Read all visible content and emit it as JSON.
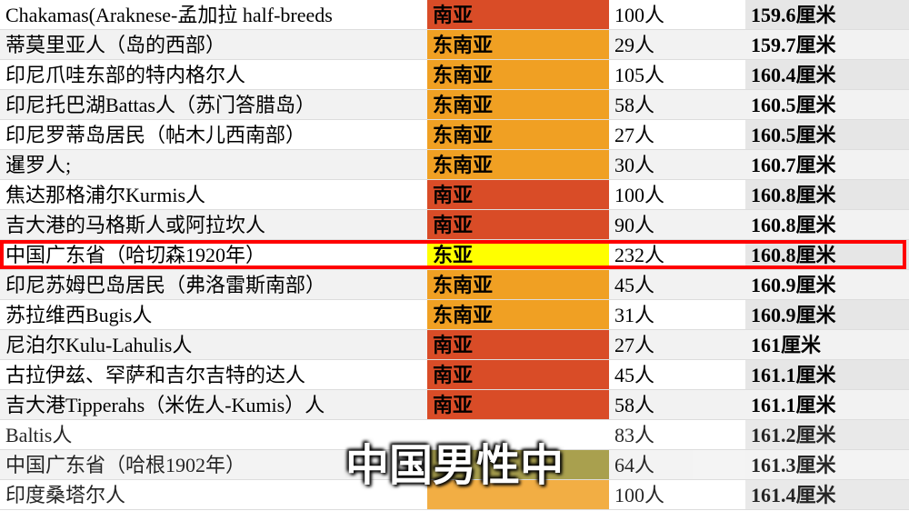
{
  "caption": "中国男性中",
  "region_colors": {
    "南亚": "region-south-asia",
    "东南亚": "region-southeast-asia",
    "东亚": "region-east-asia",
    "olive": "region-olive",
    "blank": "region-blank"
  },
  "chart_data": {
    "type": "table",
    "title": "",
    "columns": [
      "population_name",
      "region",
      "sample_count",
      "height_cm"
    ],
    "rows": [
      {
        "name": "Chakamas(Araknese-孟加拉 half-breeds",
        "region": "南亚",
        "region_class": "region-south-asia",
        "count": "100人",
        "height": "159.6厘米",
        "highlight": false
      },
      {
        "name": "蒂莫里亚人（岛的西部）",
        "region": "东南亚",
        "region_class": "region-southeast-asia",
        "count": "29人",
        "height": "159.7厘米",
        "highlight": false
      },
      {
        "name": "印尼爪哇东部的特内格尔人",
        "region": "东南亚",
        "region_class": "region-southeast-asia",
        "count": "105人",
        "height": "160.4厘米",
        "highlight": false
      },
      {
        "name": "印尼托巴湖Battas人（苏门答腊岛）",
        "region": "东南亚",
        "region_class": "region-southeast-asia",
        "count": "58人",
        "height": "160.5厘米",
        "highlight": false
      },
      {
        "name": "印尼罗蒂岛居民（帖木儿西南部）",
        "region": "东南亚",
        "region_class": "region-southeast-asia",
        "count": "27人",
        "height": "160.5厘米",
        "highlight": false
      },
      {
        "name": "暹罗人;",
        "region": "东南亚",
        "region_class": "region-southeast-asia",
        "count": "30人",
        "height": "160.7厘米",
        "highlight": false
      },
      {
        "name": "焦达那格浦尔Kurmis人",
        "region": "南亚",
        "region_class": "region-south-asia",
        "count": "100人",
        "height": "160.8厘米",
        "highlight": false
      },
      {
        "name": "吉大港的马格斯人或阿拉坎人",
        "region": "南亚",
        "region_class": "region-south-asia",
        "count": "90人",
        "height": "160.8厘米",
        "highlight": false
      },
      {
        "name": "中国广东省（哈切森1920年）",
        "region": "东亚",
        "region_class": "region-east-asia",
        "count": "232人",
        "height": "160.8厘米",
        "highlight": true
      },
      {
        "name": "印尼苏姆巴岛居民（弗洛雷斯南部）",
        "region": "东南亚",
        "region_class": "region-southeast-asia",
        "count": "45人",
        "height": "160.9厘米",
        "highlight": false
      },
      {
        "name": "苏拉维西Bugis人",
        "region": "东南亚",
        "region_class": "region-southeast-asia",
        "count": "31人",
        "height": "160.9厘米",
        "highlight": false
      },
      {
        "name": "尼泊尔Kulu-Lahulis人",
        "region": "南亚",
        "region_class": "region-south-asia",
        "count": "27人",
        "height": "161厘米",
        "highlight": false
      },
      {
        "name": "古拉伊兹、罕萨和吉尔吉特的达人",
        "region": "南亚",
        "region_class": "region-south-asia",
        "count": "45人",
        "height": "161.1厘米",
        "highlight": false
      },
      {
        "name": "吉大港Tipperahs（米佐人-Kumis）人",
        "region": "南亚",
        "region_class": "region-south-asia",
        "count": "58人",
        "height": "161.1厘米",
        "highlight": false
      },
      {
        "name": "Baltis人",
        "region": "",
        "region_class": "region-blank",
        "count": "83人",
        "height": "161.2厘米",
        "highlight": false
      },
      {
        "name": "中国广东省（哈根1902年）",
        "region": "",
        "region_class": "region-olive",
        "count": "64人",
        "height": "161.3厘米",
        "highlight": false
      },
      {
        "name": "印度桑塔尔人",
        "region": "",
        "region_class": "region-southeast-asia",
        "count": "100人",
        "height": "161.4厘米",
        "highlight": false
      }
    ]
  }
}
